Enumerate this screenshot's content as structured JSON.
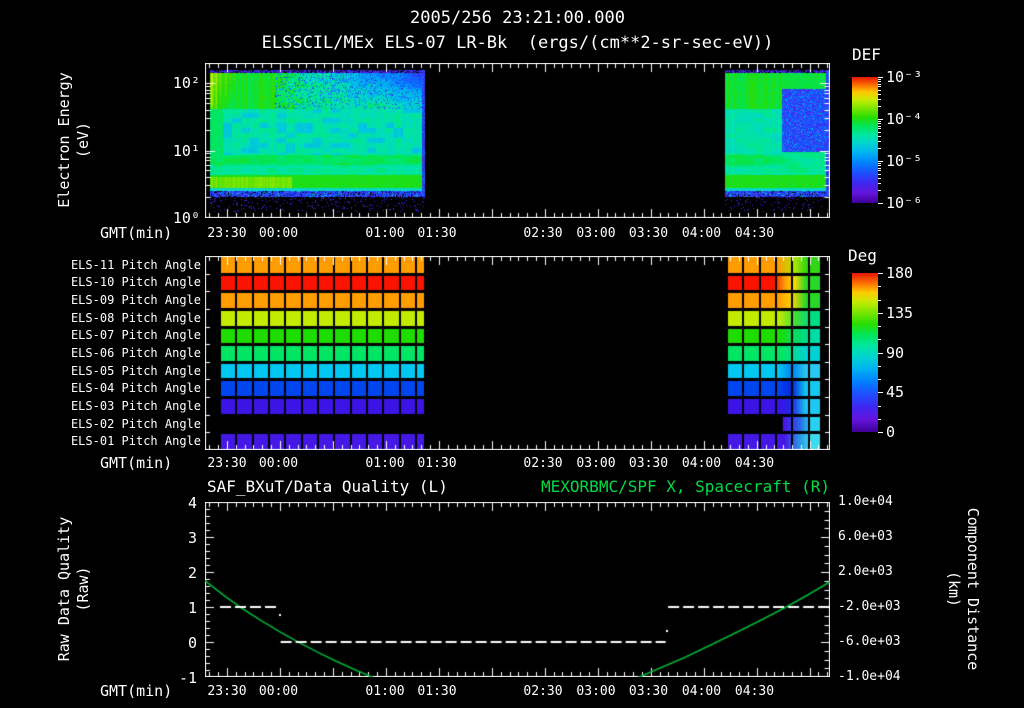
{
  "header": {
    "datetime": "2005/256 23:21:00.000",
    "title": "ELSSCIL/MEx ELS-07 LR-Bk  (ergs/(cm**2-sr-sec-eV))"
  },
  "time_axis": {
    "label": "GMT(min)",
    "start": "23:21",
    "ticks": [
      {
        "t": "23:30",
        "u": 0.0352
      },
      {
        "t": "00:00",
        "u": 0.1176
      },
      {
        "t": "01:00",
        "u": 0.288
      },
      {
        "t": "01:30",
        "u": 0.3712
      },
      {
        "t": "02:30",
        "u": 0.5408
      },
      {
        "t": "03:00",
        "u": 0.6256
      },
      {
        "t": "03:30",
        "u": 0.7096
      },
      {
        "t": "04:00",
        "u": 0.7944
      },
      {
        "t": "04:30",
        "u": 0.8792
      }
    ],
    "minor_u0": 0.00695,
    "minor_du": 0.014125
  },
  "panel1": {
    "ylabel_line1": "Electron Energy",
    "ylabel_line2": "(eV)",
    "yticks": [
      {
        "label": "10²",
        "y": 83
      },
      {
        "label": "10¹",
        "y": 150.5
      },
      {
        "label": "10⁰",
        "y": 218
      }
    ],
    "colorbar": {
      "title": "DEF",
      "labels": [
        "10⁻³",
        "10⁻⁴",
        "10⁻⁵",
        "10⁻⁶"
      ]
    }
  },
  "panel2": {
    "colorbar": {
      "title": "Deg",
      "labels": [
        "180",
        "135",
        "90",
        "45",
        "0"
      ]
    }
  },
  "panel3": {
    "title_left": "SAF_BXuT/Data Quality (L)",
    "title_right": "MEXORBMC/SPF X, Spacecraft (R)",
    "ylabel_left_1": "Raw Data Quality",
    "ylabel_left_2": "(Raw)",
    "yticks_left": [
      "4",
      "3",
      "2",
      "1",
      "0",
      "-1"
    ],
    "ylabel_right_1": "Component Distance",
    "ylabel_right_2": "(km)",
    "yticks_right": [
      "1.0e+04",
      "6.0e+03",
      "2.0e+03",
      "-2.0e+03",
      "-6.0e+03",
      "-1.0e+04"
    ]
  },
  "colors": {
    "text": "#ffffff",
    "bg": "#000000",
    "accent_green": "#00dd44",
    "curve_green": "#00b237",
    "rainbow": [
      [
        0.0,
        "#3c0096"
      ],
      [
        0.08,
        "#6414dc"
      ],
      [
        0.16,
        "#3c28f0"
      ],
      [
        0.24,
        "#1e50ff"
      ],
      [
        0.32,
        "#0082ff"
      ],
      [
        0.4,
        "#00b4f0"
      ],
      [
        0.47,
        "#00d2d2"
      ],
      [
        0.54,
        "#00e6a0"
      ],
      [
        0.61,
        "#00e65a"
      ],
      [
        0.68,
        "#28dc00"
      ],
      [
        0.75,
        "#78e600"
      ],
      [
        0.82,
        "#c8eb00"
      ],
      [
        0.88,
        "#ffc800"
      ],
      [
        0.93,
        "#ff7800"
      ],
      [
        1.0,
        "#e61400"
      ]
    ]
  },
  "chart_data": [
    {
      "type": "heatmap",
      "name": "electron-energy-spectrogram",
      "title": "ELSSCIL/MEx ELS-07 LR-Bk",
      "units": "ergs/(cm**2-sr-sec-eV)",
      "xlabel": "GMT(min)",
      "ylabel": "Electron Energy (eV)",
      "y_range_eV": [
        1,
        300
      ],
      "value_range": [
        1e-06,
        0.001
      ],
      "data_blocks_u": [
        {
          "u0": 0.008,
          "u1": 0.351,
          "note": "continuous green/yellow spectrum, blue speckle at high energy late, bright green band near 3-5 eV, purple noise below 3 eV"
        },
        {
          "u0": 0.832,
          "u1": 0.997,
          "note": "green spectrum; dark blue depletion at mid energies after u=0.92"
        }
      ]
    },
    {
      "type": "heatmap",
      "name": "pitch-angle-panels",
      "value_units": "Deg",
      "value_range": [
        0,
        180
      ],
      "left_block_u": [
        0.024,
        0.351
      ],
      "right_block_u": [
        0.835,
        0.984
      ],
      "rows": [
        {
          "label": "ELS-11 Pitch Angle",
          "base": "#ff9c00",
          "right_start": 0,
          "right": [
            [
              0,
              "#ff9c00"
            ],
            [
              0.55,
              "#ff9c00"
            ],
            [
              0.72,
              "#b4e600"
            ],
            [
              0.85,
              "#32d714"
            ],
            [
              1,
              "#32d714"
            ]
          ]
        },
        {
          "label": "ELS-10 Pitch Angle",
          "base": "#fa1400",
          "right_start": 0,
          "right": [
            [
              0,
              "#fa1400"
            ],
            [
              0.5,
              "#fa1400"
            ],
            [
              0.62,
              "#ff9c00"
            ],
            [
              0.72,
              "#ffdc00"
            ],
            [
              0.85,
              "#28d728"
            ],
            [
              1,
              "#28d728"
            ]
          ]
        },
        {
          "label": "ELS-09 Pitch Angle",
          "base": "#ff9c00",
          "right_start": 0,
          "right": [
            [
              0,
              "#ff9c00"
            ],
            [
              0.55,
              "#ff9c00"
            ],
            [
              0.7,
              "#ffd200"
            ],
            [
              0.85,
              "#28d728"
            ],
            [
              1,
              "#28d728"
            ]
          ]
        },
        {
          "label": "ELS-08 Pitch Angle",
          "base": "#c3eb00",
          "right_start": 0,
          "right": [
            [
              0,
              "#c3eb00"
            ],
            [
              0.55,
              "#c3eb00"
            ],
            [
              0.75,
              "#3cdc3c"
            ],
            [
              0.9,
              "#00dc82"
            ],
            [
              1,
              "#00dc82"
            ]
          ]
        },
        {
          "label": "ELS-07 Pitch Angle",
          "base": "#1edc00",
          "right_start": 0,
          "right": [
            [
              0,
              "#1edc00"
            ],
            [
              0.55,
              "#1edc00"
            ],
            [
              0.8,
              "#00dc78"
            ],
            [
              0.95,
              "#00dcaa"
            ],
            [
              1,
              "#00dcaa"
            ]
          ]
        },
        {
          "label": "ELS-06 Pitch Angle",
          "base": "#00e664",
          "right_start": 0,
          "right": [
            [
              0,
              "#00e664"
            ],
            [
              0.6,
              "#00e664"
            ],
            [
              0.85,
              "#00d2d2"
            ],
            [
              1,
              "#00d2d2"
            ]
          ]
        },
        {
          "label": "ELS-05 Pitch Angle",
          "base": "#00c8f0",
          "right_start": 0,
          "right": [
            [
              0,
              "#00c8f0"
            ],
            [
              0.55,
              "#00c8f0"
            ],
            [
              0.7,
              "#0082f0"
            ],
            [
              0.85,
              "#28c8f0"
            ],
            [
              1,
              "#28c8f0"
            ]
          ]
        },
        {
          "label": "ELS-04 Pitch Angle",
          "base": "#0046f0",
          "right_start": 0,
          "right": [
            [
              0,
              "#0046f0"
            ],
            [
              0.55,
              "#0046f0"
            ],
            [
              0.7,
              "#0028dc"
            ],
            [
              0.85,
              "#14c8f0"
            ],
            [
              1,
              "#14c8f0"
            ]
          ]
        },
        {
          "label": "ELS-03 Pitch Angle",
          "base": "#3c14e6",
          "right_start": 0,
          "right": [
            [
              0,
              "#3c14e6"
            ],
            [
              0.55,
              "#3c14e6"
            ],
            [
              0.7,
              "#1e28e6"
            ],
            [
              0.85,
              "#1ec8f0"
            ],
            [
              1,
              "#1ec8f0"
            ]
          ]
        },
        {
          "label": "ELS-02 Pitch Angle",
          "base": null,
          "right_start": 0.6,
          "right": [
            [
              0,
              "#4618e6"
            ],
            [
              0.62,
              "#4618e6"
            ],
            [
              0.78,
              "#2864e6"
            ],
            [
              0.9,
              "#28d0f0"
            ],
            [
              1,
              "#28d0f0"
            ]
          ]
        },
        {
          "label": "ELS-01 Pitch Angle",
          "base": "#4618e6",
          "right_start": 0,
          "right": [
            [
              0,
              "#4618e6"
            ],
            [
              0.62,
              "#4618e6"
            ],
            [
              0.78,
              "#2896e6"
            ],
            [
              0.9,
              "#3cdcf0"
            ],
            [
              1,
              "#3cdcf0"
            ]
          ]
        }
      ]
    },
    {
      "type": "line",
      "name": "quality-and-distance",
      "ylim_left": [
        -1,
        4
      ],
      "ylim_right": [
        -10000,
        10000
      ],
      "series": [
        {
          "name": "SAF_BXuT/Data Quality (L)",
          "axis": "left",
          "style": "dashed-white",
          "segments": [
            {
              "v": 1,
              "u0": 0.024,
              "u1": 0.118
            },
            {
              "v": 0,
              "u0": 0.121,
              "u1": 0.737
            },
            {
              "v": 1,
              "u0": 0.741,
              "u1": 0.999
            }
          ],
          "dots": [
            [
              0.12,
              0.78
            ],
            [
              0.739,
              0.32
            ]
          ]
        },
        {
          "name": "MEXORBMC/SPF X, Spacecraft (R)",
          "axis": "right",
          "style": "solid-green",
          "points_km": [
            [
              0.0,
              1000
            ],
            [
              0.03,
              -680
            ],
            [
              0.06,
              -2200
            ],
            [
              0.09,
              -3560
            ],
            [
              0.12,
              -4840
            ],
            [
              0.15,
              -6040
            ],
            [
              0.18,
              -7160
            ],
            [
              0.21,
              -8200
            ],
            [
              0.24,
              -9160
            ],
            [
              0.27,
              -10080
            ],
            [
              0.3,
              -10920
            ],
            null,
            [
              0.665,
              -10880
            ],
            [
              0.695,
              -10000
            ],
            [
              0.73,
              -8920
            ],
            [
              0.77,
              -7680
            ],
            [
              0.81,
              -6320
            ],
            [
              0.85,
              -4920
            ],
            [
              0.89,
              -3480
            ],
            [
              0.93,
              -2000
            ],
            [
              0.965,
              -600
            ],
            [
              1.0,
              880
            ]
          ]
        }
      ]
    }
  ]
}
